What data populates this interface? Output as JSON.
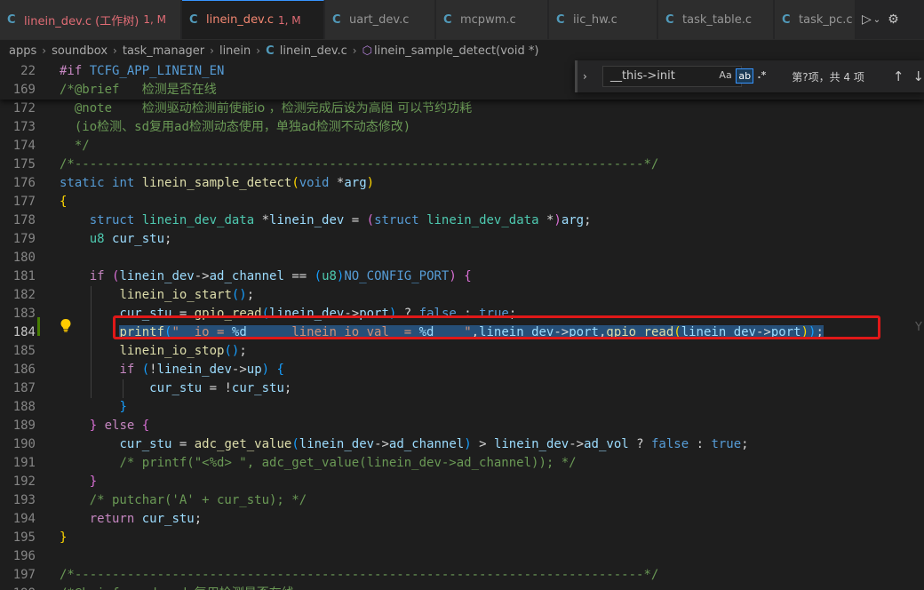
{
  "tabs": [
    {
      "label": "linein_dev.c (工作树)",
      "suffix": "1, M",
      "active": false
    },
    {
      "label": "linein_dev.c",
      "suffix": "1, M",
      "active": true
    },
    {
      "label": "uart_dev.c",
      "suffix": "",
      "active": false
    },
    {
      "label": "mcpwm.c",
      "suffix": "",
      "active": false
    },
    {
      "label": "iic_hw.c",
      "suffix": "",
      "active": false
    },
    {
      "label": "task_table.c",
      "suffix": "",
      "active": false
    },
    {
      "label": "task_pc.c",
      "suffix": "",
      "active": false
    }
  ],
  "tab_icon_glyph": "C",
  "breadcrumb": {
    "items": [
      "apps",
      "soundbox",
      "task_manager",
      "linein",
      "linein_dev.c",
      "linein_sample_detect(void *)"
    ]
  },
  "find": {
    "value": "__this->init",
    "case_label": "Aa",
    "word_label": "ab",
    "regex_label": ".*",
    "count_text": "第?项，共 4 项",
    "prev_glyph": "↑",
    "next_glyph": "↓"
  },
  "icons": [
    "c-file-icon",
    "chevron-right-icon",
    "function-icon",
    "run-icon",
    "settings-icon",
    "lightbulb-icon",
    "arrow-up-icon",
    "arrow-down-icon"
  ],
  "colors": {
    "highlight_box": "#e01818",
    "selection": "#264f78",
    "modified": "#e06c75",
    "accent": "#3794ff"
  },
  "ghost_text": "Y",
  "lines": [
    {
      "n": "22",
      "sticky": true,
      "tokens": [
        [
          "pp",
          "#if "
        ],
        [
          "macro",
          "TCFG_APP_LINEIN_EN"
        ]
      ]
    },
    {
      "n": "169",
      "sticky": true,
      "tokens": [
        [
          "cm",
          "/*@brief   "
        ],
        [
          "cm cjk",
          "检测是否在线"
        ]
      ]
    },
    {
      "n": "172",
      "tokens": [
        [
          "cm",
          "  @note    "
        ],
        [
          "cm cjk",
          "检测驱动检测前使能io ，检测完成后设为高阻 可以节约功耗"
        ]
      ]
    },
    {
      "n": "173",
      "tokens": [
        [
          "cm",
          "  (io"
        ],
        [
          "cm cjk",
          "检测、"
        ],
        [
          "cm",
          "sd"
        ],
        [
          "cm cjk",
          "复用"
        ],
        [
          "cm",
          "ad"
        ],
        [
          "cm cjk",
          "检测动态使用，单独"
        ],
        [
          "cm",
          "ad"
        ],
        [
          "cm cjk",
          "检测不动态修改"
        ],
        [
          "cm",
          ")"
        ]
      ]
    },
    {
      "n": "174",
      "tokens": [
        [
          "cm",
          "  */"
        ]
      ]
    },
    {
      "n": "175",
      "tokens": [
        [
          "cm",
          "/*----------------------------------------------------------------------------*/"
        ]
      ]
    },
    {
      "n": "176",
      "tokens": [
        [
          "kw",
          "static "
        ],
        [
          "kw",
          "int "
        ],
        [
          "fn",
          "linein_sample_detect"
        ],
        [
          "br1",
          "("
        ],
        [
          "kw",
          "void "
        ],
        [
          "pun",
          "*"
        ],
        [
          "var",
          "arg"
        ],
        [
          "br1",
          ")"
        ]
      ]
    },
    {
      "n": "177",
      "tokens": [
        [
          "br1",
          "{"
        ]
      ]
    },
    {
      "n": "178",
      "tokens": [
        [
          "pun",
          "    "
        ],
        [
          "kw",
          "struct "
        ],
        [
          "ty",
          "linein_dev_data "
        ],
        [
          "pun",
          "*"
        ],
        [
          "var",
          "linein_dev"
        ],
        [
          "pun",
          " = "
        ],
        [
          "br2",
          "("
        ],
        [
          "kw",
          "struct "
        ],
        [
          "ty",
          "linein_dev_data "
        ],
        [
          "pun",
          "*"
        ],
        [
          "br2",
          ")"
        ],
        [
          "var",
          "arg"
        ],
        [
          "pun",
          ";"
        ]
      ]
    },
    {
      "n": "179",
      "tokens": [
        [
          "pun",
          "    "
        ],
        [
          "ty",
          "u8 "
        ],
        [
          "var",
          "cur_stu"
        ],
        [
          "pun",
          ";"
        ]
      ]
    },
    {
      "n": "180",
      "tokens": []
    },
    {
      "n": "181",
      "tokens": [
        [
          "pun",
          "    "
        ],
        [
          "kw2",
          "if "
        ],
        [
          "br2",
          "("
        ],
        [
          "var",
          "linein_dev"
        ],
        [
          "pun",
          "->"
        ],
        [
          "var",
          "ad_channel"
        ],
        [
          "pun",
          " == "
        ],
        [
          "br3",
          "("
        ],
        [
          "ty",
          "u8"
        ],
        [
          "br3",
          ")"
        ],
        [
          "macro",
          "NO_CONFIG_PORT"
        ],
        [
          "br2",
          ")"
        ],
        [
          "pun",
          " "
        ],
        [
          "br2",
          "{"
        ]
      ]
    },
    {
      "n": "182",
      "tokens": [
        [
          "pun",
          "        "
        ],
        [
          "fn",
          "linein_io_start"
        ],
        [
          "br3",
          "()"
        ],
        [
          "pun",
          ";"
        ]
      ]
    },
    {
      "n": "183",
      "tokens": [
        [
          "pun",
          "        "
        ],
        [
          "var",
          "cur_stu"
        ],
        [
          "pun",
          " = "
        ],
        [
          "fn",
          "gpio_read"
        ],
        [
          "br3",
          "("
        ],
        [
          "var",
          "linein_dev"
        ],
        [
          "pun",
          "->"
        ],
        [
          "var",
          "port"
        ],
        [
          "br3",
          ")"
        ],
        [
          "pun",
          " ? "
        ],
        [
          "kw",
          "false"
        ],
        [
          "pun",
          " : "
        ],
        [
          "kw",
          "true"
        ],
        [
          "pun",
          ";"
        ]
      ]
    },
    {
      "n": "184",
      "current": true,
      "selected": true,
      "tokens": [
        [
          "pun",
          "        "
        ],
        [
          "fn",
          "printf"
        ],
        [
          "br3",
          "("
        ],
        [
          "str",
          "\"  io = "
        ],
        [
          "fmt",
          "%d"
        ],
        [
          "str",
          "      linein io val  = "
        ],
        [
          "fmt",
          "%d"
        ],
        [
          "str",
          "    \""
        ],
        [
          "pun",
          ","
        ],
        [
          "var",
          "linein_dev"
        ],
        [
          "pun",
          "->"
        ],
        [
          "var",
          "port"
        ],
        [
          "pun",
          ","
        ],
        [
          "fn",
          "gpio_read"
        ],
        [
          "br1",
          "("
        ],
        [
          "var",
          "linein_dev"
        ],
        [
          "pun",
          "->"
        ],
        [
          "var",
          "port"
        ],
        [
          "br1",
          ")"
        ],
        [
          "br3",
          ")"
        ],
        [
          "pun",
          ";"
        ]
      ]
    },
    {
      "n": "185",
      "tokens": [
        [
          "pun",
          "        "
        ],
        [
          "fn",
          "linein_io_stop"
        ],
        [
          "br3",
          "()"
        ],
        [
          "pun",
          ";"
        ]
      ]
    },
    {
      "n": "186",
      "tokens": [
        [
          "pun",
          "        "
        ],
        [
          "kw2",
          "if "
        ],
        [
          "br3",
          "("
        ],
        [
          "pun",
          "!"
        ],
        [
          "var",
          "linein_dev"
        ],
        [
          "pun",
          "->"
        ],
        [
          "var",
          "up"
        ],
        [
          "br3",
          ")"
        ],
        [
          "pun",
          " "
        ],
        [
          "br3",
          "{"
        ]
      ]
    },
    {
      "n": "187",
      "tokens": [
        [
          "pun",
          "            "
        ],
        [
          "var",
          "cur_stu"
        ],
        [
          "pun",
          " = !"
        ],
        [
          "var",
          "cur_stu"
        ],
        [
          "pun",
          ";"
        ]
      ]
    },
    {
      "n": "188",
      "tokens": [
        [
          "pun",
          "        "
        ],
        [
          "br3",
          "}"
        ]
      ]
    },
    {
      "n": "189",
      "tokens": [
        [
          "pun",
          "    "
        ],
        [
          "br2",
          "}"
        ],
        [
          "pun",
          " "
        ],
        [
          "kw2",
          "else "
        ],
        [
          "br2",
          "{"
        ]
      ]
    },
    {
      "n": "190",
      "tokens": [
        [
          "pun",
          "        "
        ],
        [
          "var",
          "cur_stu"
        ],
        [
          "pun",
          " = "
        ],
        [
          "fn",
          "adc_get_value"
        ],
        [
          "br3",
          "("
        ],
        [
          "var",
          "linein_dev"
        ],
        [
          "pun",
          "->"
        ],
        [
          "var",
          "ad_channel"
        ],
        [
          "br3",
          ")"
        ],
        [
          "pun",
          " > "
        ],
        [
          "var",
          "linein_dev"
        ],
        [
          "pun",
          "->"
        ],
        [
          "var",
          "ad_vol"
        ],
        [
          "pun",
          " ? "
        ],
        [
          "kw",
          "false"
        ],
        [
          "pun",
          " : "
        ],
        [
          "kw",
          "true"
        ],
        [
          "pun",
          ";"
        ]
      ]
    },
    {
      "n": "191",
      "tokens": [
        [
          "pun",
          "        "
        ],
        [
          "cm",
          "/* printf(\"<%d> \", adc_get_value(linein_dev->ad_channel)); */"
        ]
      ]
    },
    {
      "n": "192",
      "tokens": [
        [
          "pun",
          "    "
        ],
        [
          "br2",
          "}"
        ]
      ]
    },
    {
      "n": "193",
      "tokens": [
        [
          "pun",
          "    "
        ],
        [
          "cm",
          "/* putchar('A' + cur_stu); */"
        ]
      ]
    },
    {
      "n": "194",
      "tokens": [
        [
          "pun",
          "    "
        ],
        [
          "kw2",
          "return "
        ],
        [
          "var",
          "cur_stu"
        ],
        [
          "pun",
          ";"
        ]
      ]
    },
    {
      "n": "195",
      "tokens": [
        [
          "br1",
          "}"
        ]
      ]
    },
    {
      "n": "196",
      "tokens": []
    },
    {
      "n": "197",
      "tokens": [
        [
          "cm",
          "/*----------------------------------------------------------------------------*/"
        ]
      ]
    },
    {
      "n": "198",
      "tokens": [
        [
          "cm",
          "/*@brief   sd_cmd "
        ],
        [
          "cm cjk",
          "复用检测是否在线"
        ]
      ]
    }
  ]
}
